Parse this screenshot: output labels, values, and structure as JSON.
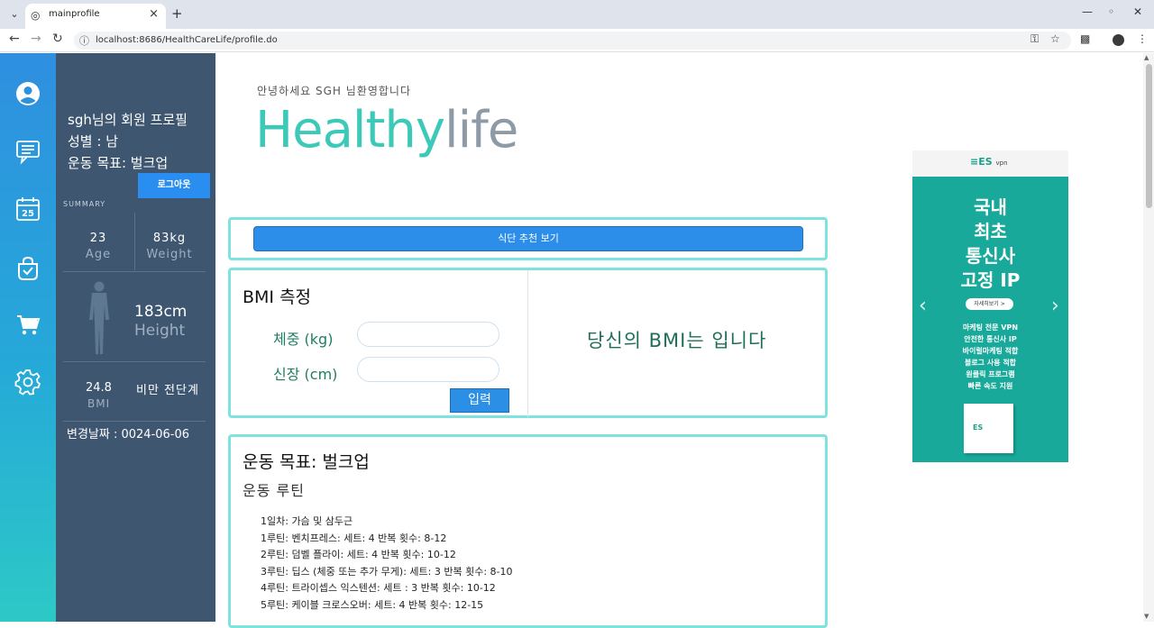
{
  "browser": {
    "tab_title": "mainprofile",
    "url": "localhost:8686/HealthCareLife/profile.do",
    "icons": {
      "tab_list": "chevron-down-icon",
      "favicon": "globe-icon",
      "close": "close-icon",
      "new_tab": "plus-icon",
      "minimize": "minimize-icon",
      "restore": "restore-icon",
      "window_close": "close-icon",
      "back": "arrow-left-icon",
      "forward": "arrow-right-icon",
      "reload": "reload-icon",
      "site_info": "info-icon",
      "password": "key-icon",
      "bookmark": "star-icon",
      "extensions": "puzzle-icon",
      "menu": "kebab-icon"
    }
  },
  "sidebar": {
    "icons": [
      "user-icon",
      "chat-icon",
      "calendar-icon",
      "bag-check-icon",
      "cart-icon",
      "gear-icon"
    ],
    "calendar_day": "25"
  },
  "profile": {
    "title": "sgh님의 회원 프로필",
    "gender": "성별 : 남",
    "goal": "운동 목표: 벌크업",
    "logout_label": "로그아웃",
    "summary_label": "SUMMARY",
    "age_value": "23",
    "age_label": "Age",
    "weight_value": "83kg",
    "weight_label": "Weight",
    "height_value": "183cm",
    "height_label": "Height",
    "bmi_value": "24.8",
    "bmi_label": "BMI",
    "bmi_status": "비만 전단계",
    "changed_date": "변경날짜 : 0024-06-06"
  },
  "header": {
    "greeting": "안녕하세요 SGH 님환영합니다",
    "brand_part1": "Healthy",
    "brand_part2": "life"
  },
  "diet": {
    "button_label": "식단 추천 보기"
  },
  "bmi_form": {
    "title": "BMI 측정",
    "weight_label": "체중 (kg)",
    "weight_value": "",
    "height_label": "신장 (cm)",
    "height_value": "",
    "submit_label": "입력",
    "result_text": "당신의 BMI는 입니다"
  },
  "exercise": {
    "title": "운동 목표: 벌크업",
    "subtitle": "운동 루틴",
    "lines": [
      "1일차: 가슴 및 삼두근",
      "1루틴: 벤치프레스: 세트: 4 반복 횟수: 8-12",
      "2루틴: 덤벨 플라이: 세트: 4 반복 횟수: 10-12",
      "3루틴: 딥스 (체중 또는 추가 무게): 세트: 3 반복 횟수: 8-10",
      "4루틴: 트라이셉스 익스텐션: 세트 : 3 반복 횟수: 10-12",
      "5루틴: 케이블 크로스오버: 세트: 4 반복 횟수: 12-15"
    ]
  },
  "ad": {
    "logo": "ES",
    "logo_sub": "vpn",
    "headline": [
      "국내",
      "최초",
      "통신사",
      "고정 IP"
    ],
    "more_label": "자세히보기 >",
    "features": [
      "마케팅 전문 VPN",
      "안전한 통신사 IP",
      "바이럴마케팅 적합",
      "블로그 사용 적합",
      "원클릭 프로그램",
      "빠른 속도 지원"
    ],
    "box_label": "ES",
    "prev_icon": "chevron-left-icon",
    "next_icon": "chevron-right-icon",
    "colors": {
      "background": "#19a99a"
    }
  },
  "colors": {
    "accent_teal": "#3cc9b8",
    "card_border": "#7ee3df",
    "button_blue": "#2d8eea",
    "panel_bg": "#3e5670"
  }
}
